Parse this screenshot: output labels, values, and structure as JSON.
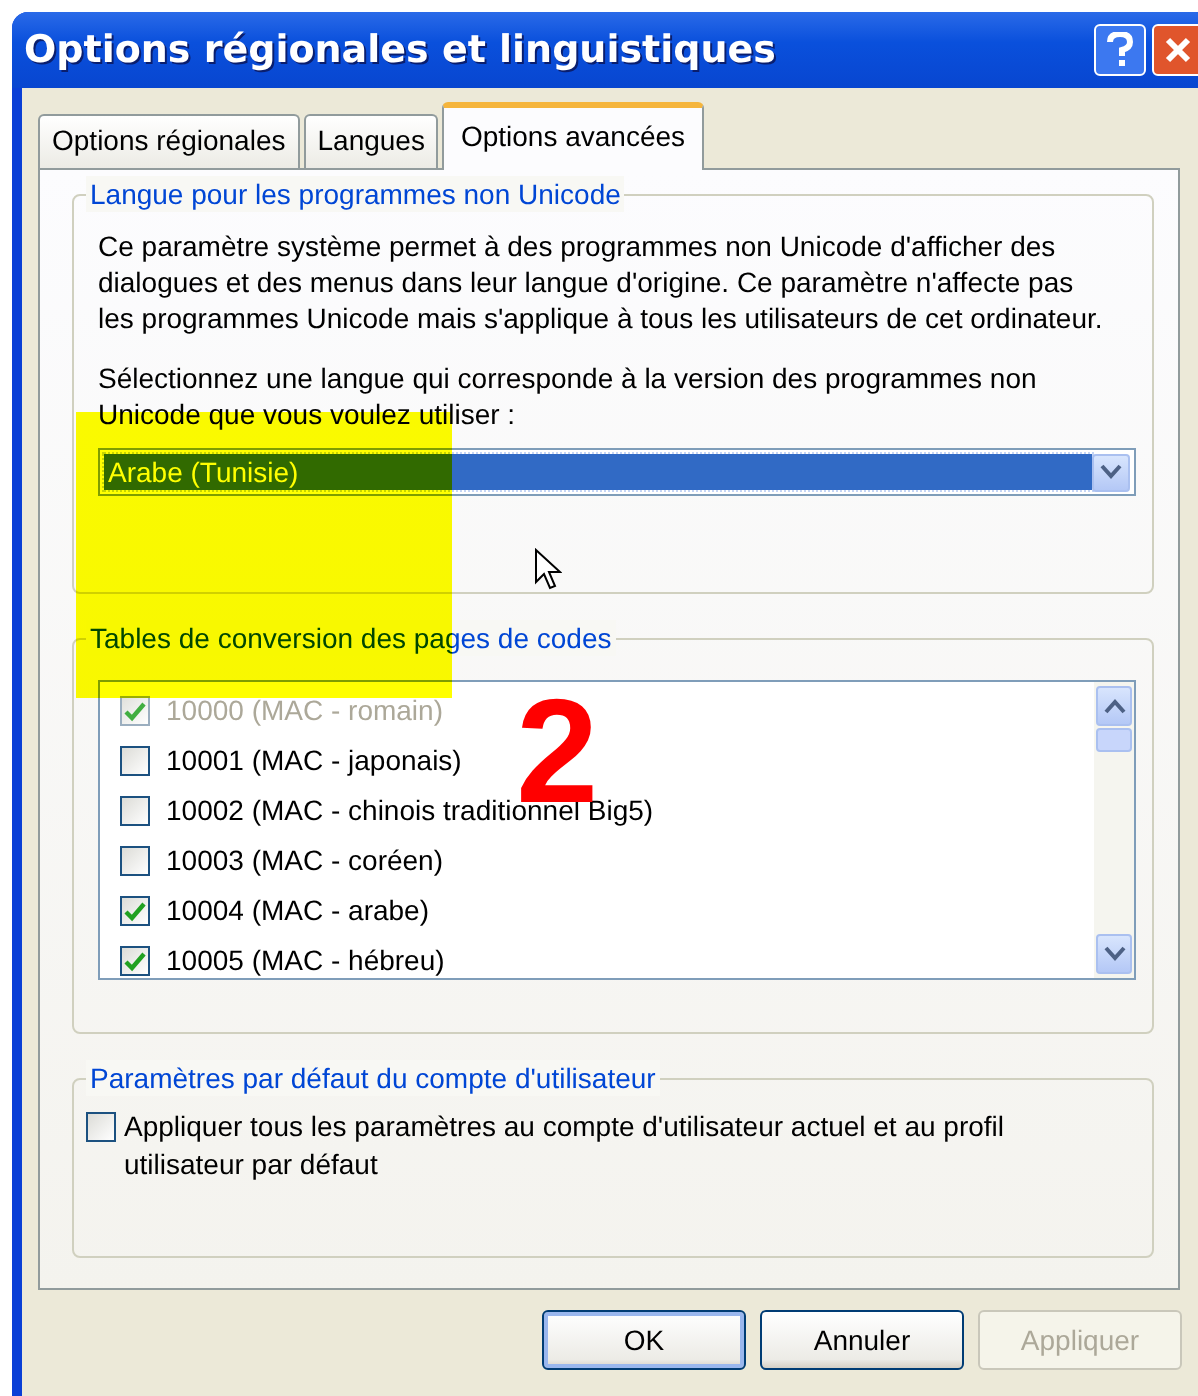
{
  "window": {
    "title": "Options régionales et linguistiques"
  },
  "tabs": [
    {
      "label": "Options régionales",
      "selected": false
    },
    {
      "label": "Langues",
      "selected": false
    },
    {
      "label": "Options avancées",
      "selected": true
    }
  ],
  "non_unicode": {
    "legend": "Langue pour les programmes non Unicode",
    "description": "Ce paramètre système permet à des programmes non Unicode d'afficher des dialogues et des menus dans leur langue d'origine. Ce paramètre n'affecte pas les programmes Unicode mais s'applique à tous les utilisateurs de cet ordinateur.",
    "prompt": "Sélectionnez une langue qui corresponde à la version des programmes non Unicode que vous voulez utiliser :",
    "language": "Arabe (Tunisie)"
  },
  "code_pages": {
    "legend": "Tables de conversion des pages de codes",
    "items": [
      {
        "label": "10000 (MAC - romain)",
        "checked": true,
        "disabled": true
      },
      {
        "label": "10001 (MAC - japonais)",
        "checked": false,
        "disabled": false
      },
      {
        "label": "10002 (MAC - chinois traditionnel Big5)",
        "checked": false,
        "disabled": false
      },
      {
        "label": "10003 (MAC - coréen)",
        "checked": false,
        "disabled": false
      },
      {
        "label": "10004 (MAC - arabe)",
        "checked": true,
        "disabled": false
      },
      {
        "label": "10005 (MAC - hébreu)",
        "checked": true,
        "disabled": false
      }
    ]
  },
  "user_defaults": {
    "legend": "Paramètres par défaut du compte d'utilisateur",
    "option": {
      "label": "Appliquer tous les paramètres au compte d'utilisateur actuel et au profil utilisateur par défaut",
      "checked": false
    }
  },
  "buttons": [
    {
      "label": "OK",
      "disabled": false,
      "default": true
    },
    {
      "label": "Annuler",
      "disabled": false,
      "default": false
    },
    {
      "label": "Appliquer",
      "disabled": true,
      "default": false
    }
  ],
  "annotation": {
    "label": "2"
  }
}
